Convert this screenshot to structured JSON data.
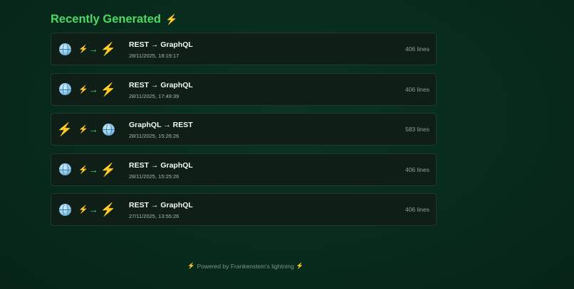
{
  "heading": {
    "title": "Recently Generated",
    "icon": "lightning-icon"
  },
  "items": [
    {
      "title": "REST → GraphQL",
      "date": "28/11/2025, 18:19:17",
      "lines": "406 lines",
      "from": "globe",
      "to": "lightning"
    },
    {
      "title": "REST → GraphQL",
      "date": "28/11/2025, 17:49:39",
      "lines": "406 lines",
      "from": "globe",
      "to": "lightning"
    },
    {
      "title": "GraphQL → REST",
      "date": "28/11/2025, 15:26:26",
      "lines": "583 lines",
      "from": "lightning",
      "to": "globe"
    },
    {
      "title": "REST → GraphQL",
      "date": "28/11/2025, 15:25:26",
      "lines": "406 lines",
      "from": "globe",
      "to": "lightning"
    },
    {
      "title": "REST → GraphQL",
      "date": "27/11/2025, 13:55:26",
      "lines": "406 lines",
      "from": "globe",
      "to": "lightning"
    }
  ],
  "arrow_glyph": "→",
  "footer": {
    "text": "Powered by Frankenstein's lightning"
  },
  "colors": {
    "accent": "#4cd964",
    "bolt": "#f5c842",
    "background": "#072a1c",
    "card": "#0f1f17"
  }
}
